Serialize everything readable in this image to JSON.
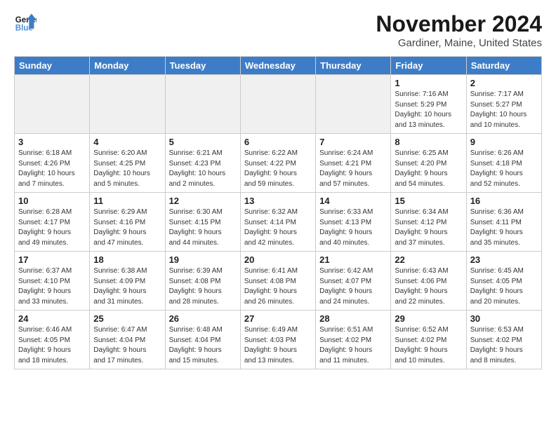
{
  "header": {
    "logo_line1": "General",
    "logo_line2": "Blue",
    "month_title": "November 2024",
    "location": "Gardiner, Maine, United States"
  },
  "days_of_week": [
    "Sunday",
    "Monday",
    "Tuesday",
    "Wednesday",
    "Thursday",
    "Friday",
    "Saturday"
  ],
  "weeks": [
    [
      {
        "num": "",
        "info": ""
      },
      {
        "num": "",
        "info": ""
      },
      {
        "num": "",
        "info": ""
      },
      {
        "num": "",
        "info": ""
      },
      {
        "num": "",
        "info": ""
      },
      {
        "num": "1",
        "info": "Sunrise: 7:16 AM\nSunset: 5:29 PM\nDaylight: 10 hours\nand 13 minutes."
      },
      {
        "num": "2",
        "info": "Sunrise: 7:17 AM\nSunset: 5:27 PM\nDaylight: 10 hours\nand 10 minutes."
      }
    ],
    [
      {
        "num": "3",
        "info": "Sunrise: 6:18 AM\nSunset: 4:26 PM\nDaylight: 10 hours\nand 7 minutes."
      },
      {
        "num": "4",
        "info": "Sunrise: 6:20 AM\nSunset: 4:25 PM\nDaylight: 10 hours\nand 5 minutes."
      },
      {
        "num": "5",
        "info": "Sunrise: 6:21 AM\nSunset: 4:23 PM\nDaylight: 10 hours\nand 2 minutes."
      },
      {
        "num": "6",
        "info": "Sunrise: 6:22 AM\nSunset: 4:22 PM\nDaylight: 9 hours\nand 59 minutes."
      },
      {
        "num": "7",
        "info": "Sunrise: 6:24 AM\nSunset: 4:21 PM\nDaylight: 9 hours\nand 57 minutes."
      },
      {
        "num": "8",
        "info": "Sunrise: 6:25 AM\nSunset: 4:20 PM\nDaylight: 9 hours\nand 54 minutes."
      },
      {
        "num": "9",
        "info": "Sunrise: 6:26 AM\nSunset: 4:18 PM\nDaylight: 9 hours\nand 52 minutes."
      }
    ],
    [
      {
        "num": "10",
        "info": "Sunrise: 6:28 AM\nSunset: 4:17 PM\nDaylight: 9 hours\nand 49 minutes."
      },
      {
        "num": "11",
        "info": "Sunrise: 6:29 AM\nSunset: 4:16 PM\nDaylight: 9 hours\nand 47 minutes."
      },
      {
        "num": "12",
        "info": "Sunrise: 6:30 AM\nSunset: 4:15 PM\nDaylight: 9 hours\nand 44 minutes."
      },
      {
        "num": "13",
        "info": "Sunrise: 6:32 AM\nSunset: 4:14 PM\nDaylight: 9 hours\nand 42 minutes."
      },
      {
        "num": "14",
        "info": "Sunrise: 6:33 AM\nSunset: 4:13 PM\nDaylight: 9 hours\nand 40 minutes."
      },
      {
        "num": "15",
        "info": "Sunrise: 6:34 AM\nSunset: 4:12 PM\nDaylight: 9 hours\nand 37 minutes."
      },
      {
        "num": "16",
        "info": "Sunrise: 6:36 AM\nSunset: 4:11 PM\nDaylight: 9 hours\nand 35 minutes."
      }
    ],
    [
      {
        "num": "17",
        "info": "Sunrise: 6:37 AM\nSunset: 4:10 PM\nDaylight: 9 hours\nand 33 minutes."
      },
      {
        "num": "18",
        "info": "Sunrise: 6:38 AM\nSunset: 4:09 PM\nDaylight: 9 hours\nand 31 minutes."
      },
      {
        "num": "19",
        "info": "Sunrise: 6:39 AM\nSunset: 4:08 PM\nDaylight: 9 hours\nand 28 minutes."
      },
      {
        "num": "20",
        "info": "Sunrise: 6:41 AM\nSunset: 4:08 PM\nDaylight: 9 hours\nand 26 minutes."
      },
      {
        "num": "21",
        "info": "Sunrise: 6:42 AM\nSunset: 4:07 PM\nDaylight: 9 hours\nand 24 minutes."
      },
      {
        "num": "22",
        "info": "Sunrise: 6:43 AM\nSunset: 4:06 PM\nDaylight: 9 hours\nand 22 minutes."
      },
      {
        "num": "23",
        "info": "Sunrise: 6:45 AM\nSunset: 4:05 PM\nDaylight: 9 hours\nand 20 minutes."
      }
    ],
    [
      {
        "num": "24",
        "info": "Sunrise: 6:46 AM\nSunset: 4:05 PM\nDaylight: 9 hours\nand 18 minutes."
      },
      {
        "num": "25",
        "info": "Sunrise: 6:47 AM\nSunset: 4:04 PM\nDaylight: 9 hours\nand 17 minutes."
      },
      {
        "num": "26",
        "info": "Sunrise: 6:48 AM\nSunset: 4:04 PM\nDaylight: 9 hours\nand 15 minutes."
      },
      {
        "num": "27",
        "info": "Sunrise: 6:49 AM\nSunset: 4:03 PM\nDaylight: 9 hours\nand 13 minutes."
      },
      {
        "num": "28",
        "info": "Sunrise: 6:51 AM\nSunset: 4:02 PM\nDaylight: 9 hours\nand 11 minutes."
      },
      {
        "num": "29",
        "info": "Sunrise: 6:52 AM\nSunset: 4:02 PM\nDaylight: 9 hours\nand 10 minutes."
      },
      {
        "num": "30",
        "info": "Sunrise: 6:53 AM\nSunset: 4:02 PM\nDaylight: 9 hours\nand 8 minutes."
      }
    ]
  ]
}
